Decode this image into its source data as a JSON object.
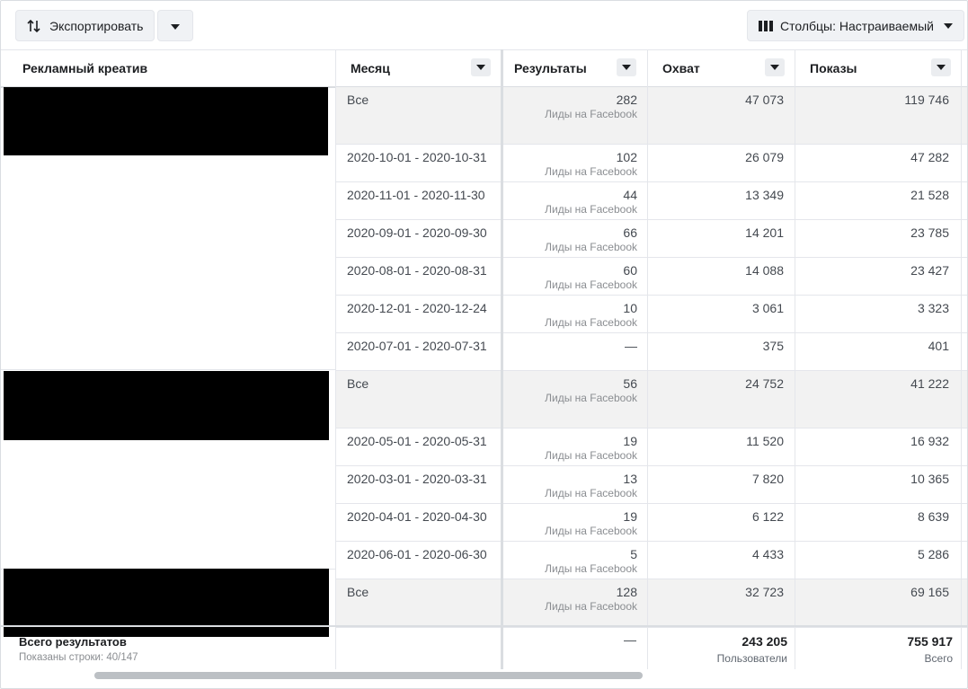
{
  "toolbar": {
    "export_label": "Экспортировать",
    "columns_label": "Столбцы: Настраиваемый"
  },
  "columns": {
    "creative": "Рекламный креатив",
    "month": "Месяц",
    "results": "Результаты",
    "reach": "Охват",
    "impressions": "Показы"
  },
  "rows": [
    {
      "month": "Все",
      "results": "282",
      "results_sub": "Лиды на Facebook",
      "reach": "47 073",
      "impressions": "119 746"
    },
    {
      "month": "2020-10-01 - 2020-10-31",
      "results": "102",
      "results_sub": "Лиды на Facebook",
      "reach": "26 079",
      "impressions": "47 282"
    },
    {
      "month": "2020-11-01 - 2020-11-30",
      "results": "44",
      "results_sub": "Лиды на Facebook",
      "reach": "13 349",
      "impressions": "21 528"
    },
    {
      "month": "2020-09-01 - 2020-09-30",
      "results": "66",
      "results_sub": "Лиды на Facebook",
      "reach": "14 201",
      "impressions": "23 785"
    },
    {
      "month": "2020-08-01 - 2020-08-31",
      "results": "60",
      "results_sub": "Лиды на Facebook",
      "reach": "14 088",
      "impressions": "23 427"
    },
    {
      "month": "2020-12-01 - 2020-12-24",
      "results": "10",
      "results_sub": "Лиды на Facebook",
      "reach": "3 061",
      "impressions": "3 323"
    },
    {
      "month": "2020-07-01 - 2020-07-31",
      "results": "—",
      "results_sub": "",
      "reach": "375",
      "impressions": "401"
    },
    {
      "month": "Все",
      "results": "56",
      "results_sub": "Лиды на Facebook",
      "reach": "24 752",
      "impressions": "41 222"
    },
    {
      "month": "2020-05-01 - 2020-05-31",
      "results": "19",
      "results_sub": "Лиды на Facebook",
      "reach": "11 520",
      "impressions": "16 932"
    },
    {
      "month": "2020-03-01 - 2020-03-31",
      "results": "13",
      "results_sub": "Лиды на Facebook",
      "reach": "7 820",
      "impressions": "10 365"
    },
    {
      "month": "2020-04-01 - 2020-04-30",
      "results": "19",
      "results_sub": "Лиды на Facebook",
      "reach": "6 122",
      "impressions": "8 639"
    },
    {
      "month": "2020-06-01 - 2020-06-30",
      "results": "5",
      "results_sub": "Лиды на Facebook",
      "reach": "4 433",
      "impressions": "5 286"
    },
    {
      "month": "Все",
      "results": "128",
      "results_sub": "Лиды на Facebook",
      "reach": "32 723",
      "impressions": "69 165"
    }
  ],
  "footer": {
    "label": "Всего результатов",
    "rows_shown": "Показаны строки: 40/147",
    "results": "—",
    "reach": "243 205",
    "reach_sub": "Пользователи",
    "impressions": "755 917",
    "impressions_sub": "Всего"
  },
  "colors": {
    "summary_row_bg": "#f2f2f2",
    "button_bg": "#f0f2f5",
    "redaction": "#000000"
  }
}
